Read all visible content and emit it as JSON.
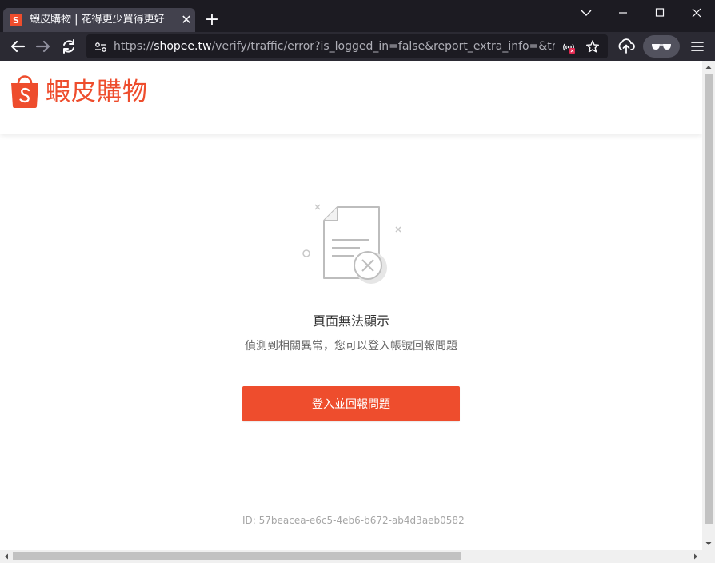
{
  "browser": {
    "tab": {
      "title": "蝦皮購物 | 花得更少買得更好",
      "favicon_letter": "S",
      "close_glyph": "✕"
    },
    "new_tab_glyph": "+",
    "url": {
      "scheme": "https://",
      "domain": "shopee.tw",
      "rest": "/verify/traffic/error?is_logged_in=false&report_extra_info=&tra..."
    },
    "icons": [
      "back-arrow-icon",
      "forward-arrow-icon",
      "reload-icon",
      "site-info-icon",
      "autoplay-blocked-icon",
      "bookmark-star-icon",
      "upload-icon",
      "incognito-glasses-icon",
      "hamburger-menu-icon",
      "chevron-down-icon",
      "minimize-icon",
      "maximize-icon",
      "close-icon"
    ],
    "colors": {
      "titlebar": "#1c1b22",
      "toolbar": "#2b2a33",
      "urlbar": "#1c1b22",
      "tab_active": "#42414d"
    }
  },
  "site": {
    "logo_text": "蝦皮購物",
    "brand_color": "#ee4d2d"
  },
  "error": {
    "title": "頁面無法顯示",
    "description": "偵測到相關異常，您可以登入帳號回報問題",
    "button_label": "登入並回報問題",
    "trace_id": "ID: 57beacea-e6c5-4eb6-b672-ab4d3aeb0582"
  }
}
